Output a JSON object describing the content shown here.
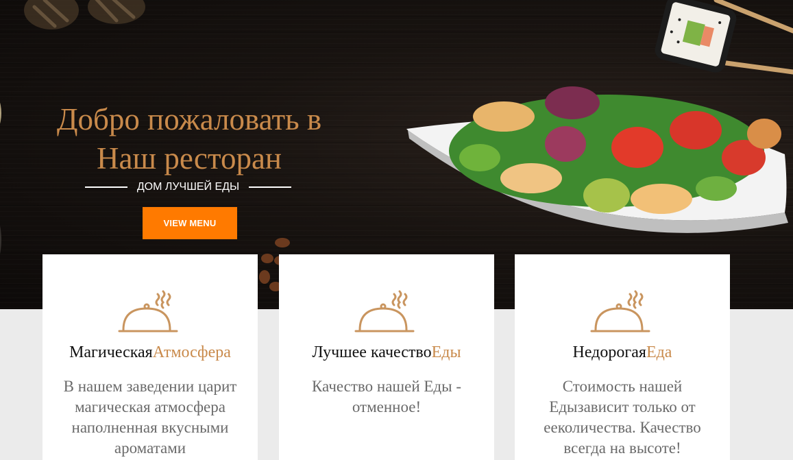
{
  "hero": {
    "title_line1": "Добро пожаловать в",
    "title_line2": "Наш ресторан",
    "tagline": "ДОМ ЛУЧШЕЙ ЕДЫ",
    "button_label": "VIEW MENU"
  },
  "colors": {
    "accent_gold": "#c98a4b",
    "button_orange": "#ff7a00",
    "hero_background": "#14100e"
  },
  "features": [
    {
      "icon": "cloche-icon",
      "title_plain": "Магическая",
      "title_accent": "Атмосфера",
      "text": "В нашем заведении царит магическая атмосфера наполненная вкусными ароматами"
    },
    {
      "icon": "cloche-icon",
      "title_plain": "Лучшее качество",
      "title_accent": "Еды",
      "text": "Качество нашей Еды - отменное!"
    },
    {
      "icon": "cloche-icon",
      "title_plain": "Недорогая",
      "title_accent": "Еда",
      "text": "Стоимость нашей Едызависит только от ееколичества. Качество всегда на высоте!"
    }
  ]
}
